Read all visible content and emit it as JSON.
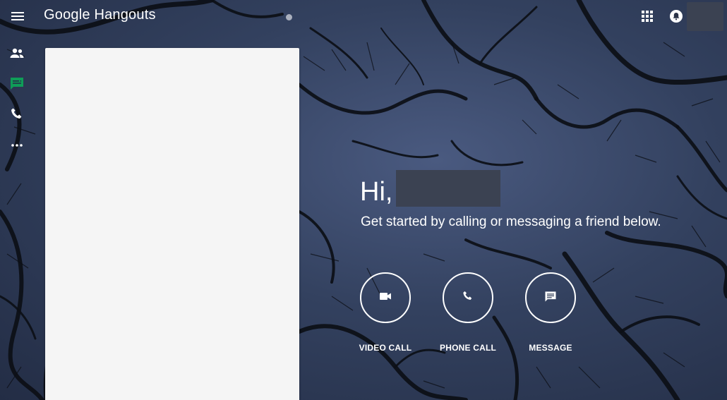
{
  "app": {
    "title": "Google Hangouts"
  },
  "icons": {
    "menu": "hamburger-menu-icon",
    "apps": "apps-grid-icon",
    "notifications": "notification-bell-icon",
    "contacts": "people-icon",
    "conversations": "chat-message-icon",
    "phone_calls": "phone-icon",
    "more": "more-horizontal-icon",
    "video_call": "videocam-icon",
    "phone_call": "phone-icon",
    "message": "message-icon"
  },
  "colors": {
    "accent": "#0f9d58",
    "panel": "#f5f5f5",
    "redaction": "#3b4252"
  },
  "greeting": {
    "hello": "Hi,",
    "subtitle": "Get started by calling or messaging a friend below."
  },
  "actions": [
    {
      "label": "VIDEO CALL"
    },
    {
      "label": "PHONE CALL"
    },
    {
      "label": "MESSAGE"
    }
  ]
}
